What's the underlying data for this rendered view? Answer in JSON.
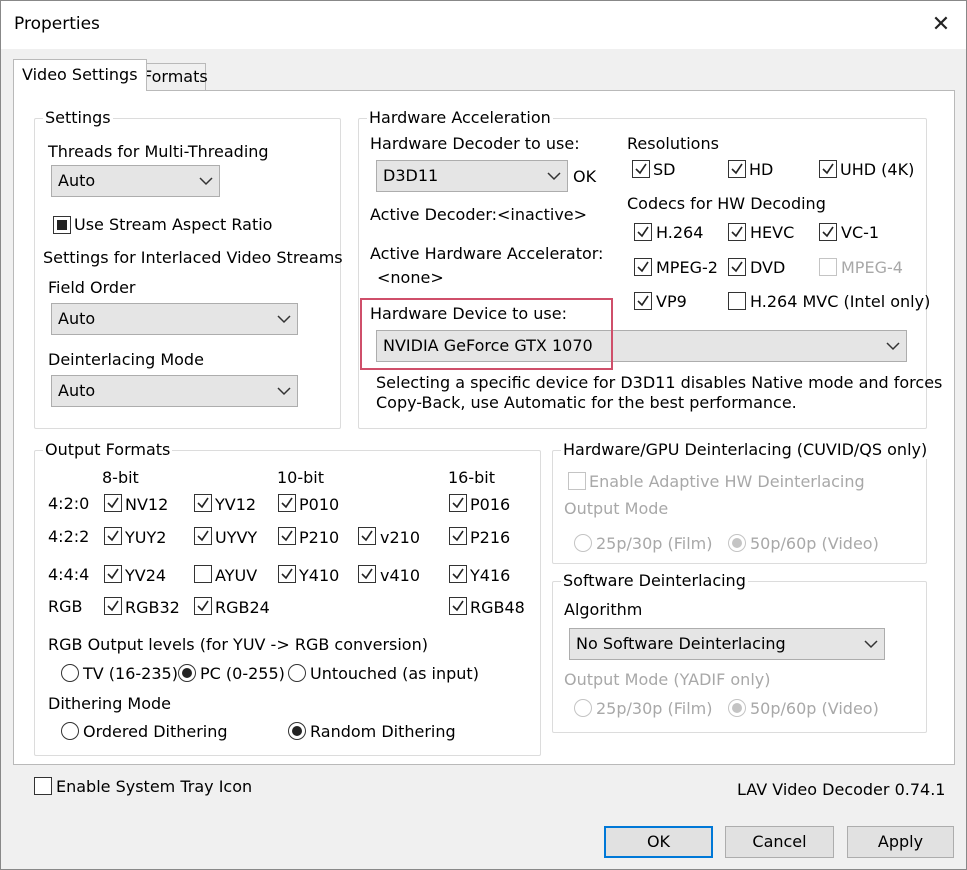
{
  "window": {
    "title": "Properties",
    "close_glyph": "✕"
  },
  "tabs": [
    {
      "label": "Video Settings"
    },
    {
      "label": "Formats"
    }
  ],
  "settings": {
    "title": "Settings",
    "threads_label": "Threads for Multi-Threading",
    "threads_value": "Auto",
    "stream_aspect": {
      "label": "Use Stream Aspect Ratio",
      "state": "indeterminate"
    },
    "interlaced_label": "Settings for Interlaced Video Streams",
    "field_order_label": "Field Order",
    "field_order_value": "Auto",
    "deint_mode_label": "Deinterlacing Mode",
    "deint_mode_value": "Auto"
  },
  "hwaccel": {
    "title": "Hardware Acceleration",
    "decoder_label": "Hardware Decoder to use:",
    "decoder_value": "D3D11",
    "decoder_status": "OK",
    "active_decoder_label": "Active Decoder:",
    "active_decoder_value": "<inactive>",
    "active_accel_label": "Active Hardware Accelerator:",
    "active_accel_value": "<none>",
    "device_label": "Hardware Device to use:",
    "device_value": "NVIDIA GeForce GTX 1070",
    "note_line1": "Selecting a specific device for D3D11 disables Native mode and forces",
    "note_line2": "Copy-Back, use Automatic for the best performance.",
    "resolutions_label": "Resolutions",
    "resolutions": [
      {
        "label": "SD",
        "checked": true
      },
      {
        "label": "HD",
        "checked": true
      },
      {
        "label": "UHD (4K)",
        "checked": true
      }
    ],
    "codecs_label": "Codecs for HW Decoding",
    "codecs": [
      {
        "label": "H.264",
        "checked": true,
        "enabled": true
      },
      {
        "label": "HEVC",
        "checked": true,
        "enabled": true
      },
      {
        "label": "VC-1",
        "checked": true,
        "enabled": true
      },
      {
        "label": "MPEG-2",
        "checked": true,
        "enabled": true
      },
      {
        "label": "DVD",
        "checked": true,
        "enabled": true
      },
      {
        "label": "MPEG-4",
        "checked": false,
        "enabled": false
      },
      {
        "label": "VP9",
        "checked": true,
        "enabled": true
      },
      {
        "label": "H.264 MVC (Intel only)",
        "checked": false,
        "enabled": true
      }
    ]
  },
  "output": {
    "title": "Output Formats",
    "col_8bit": "8-bit",
    "col_10bit": "10-bit",
    "col_16bit": "16-bit",
    "rows": [
      {
        "label": "4:2:0",
        "formats": [
          {
            "label": "NV12",
            "checked": true
          },
          {
            "label": "YV12",
            "checked": true
          },
          {
            "label": "P010",
            "checked": true
          },
          {
            "label": "P016",
            "checked": true
          }
        ]
      },
      {
        "label": "4:2:2",
        "formats": [
          {
            "label": "YUY2",
            "checked": true
          },
          {
            "label": "UYVY",
            "checked": true
          },
          {
            "label": "P210",
            "checked": true
          },
          {
            "label": "v210",
            "checked": true
          },
          {
            "label": "P216",
            "checked": true
          }
        ]
      },
      {
        "label": "4:4:4",
        "formats": [
          {
            "label": "YV24",
            "checked": true
          },
          {
            "label": "AYUV",
            "checked": false
          },
          {
            "label": "Y410",
            "checked": true
          },
          {
            "label": "v410",
            "checked": true
          },
          {
            "label": "Y416",
            "checked": true
          }
        ]
      },
      {
        "label": "RGB",
        "formats": [
          {
            "label": "RGB32",
            "checked": true
          },
          {
            "label": "RGB24",
            "checked": true
          },
          {
            "label": "RGB48",
            "checked": true
          }
        ]
      }
    ],
    "levels_label": "RGB Output levels (for YUV -> RGB conversion)",
    "levels": [
      {
        "label": "TV (16-235)",
        "selected": false
      },
      {
        "label": "PC (0-255)",
        "selected": true
      },
      {
        "label": "Untouched (as input)",
        "selected": false
      }
    ],
    "dither_label": "Dithering Mode",
    "dither": [
      {
        "label": "Ordered Dithering",
        "selected": false
      },
      {
        "label": "Random Dithering",
        "selected": true
      }
    ]
  },
  "hwdeint": {
    "title": "Hardware/GPU Deinterlacing (CUVID/QS only)",
    "adaptive_label": "Enable Adaptive HW Deinterlacing",
    "output_mode_label": "Output Mode",
    "options": [
      {
        "label": "25p/30p (Film)",
        "selected": false
      },
      {
        "label": "50p/60p (Video)",
        "selected": true
      }
    ]
  },
  "swdeint": {
    "title": "Software Deinterlacing",
    "algorithm_label": "Algorithm",
    "algorithm_value": "No Software Deinterlacing",
    "output_mode_label": "Output Mode (YADIF only)",
    "options": [
      {
        "label": "25p/30p (Film)",
        "selected": false
      },
      {
        "label": "50p/60p (Video)",
        "selected": true
      }
    ]
  },
  "tray_label": "Enable System Tray Icon",
  "version": "LAV Video Decoder 0.74.1",
  "buttons": {
    "ok": "OK",
    "cancel": "Cancel",
    "apply": "Apply"
  },
  "colors": {
    "highlight": "#cf4f6a",
    "ok_border": "#0078d7"
  }
}
